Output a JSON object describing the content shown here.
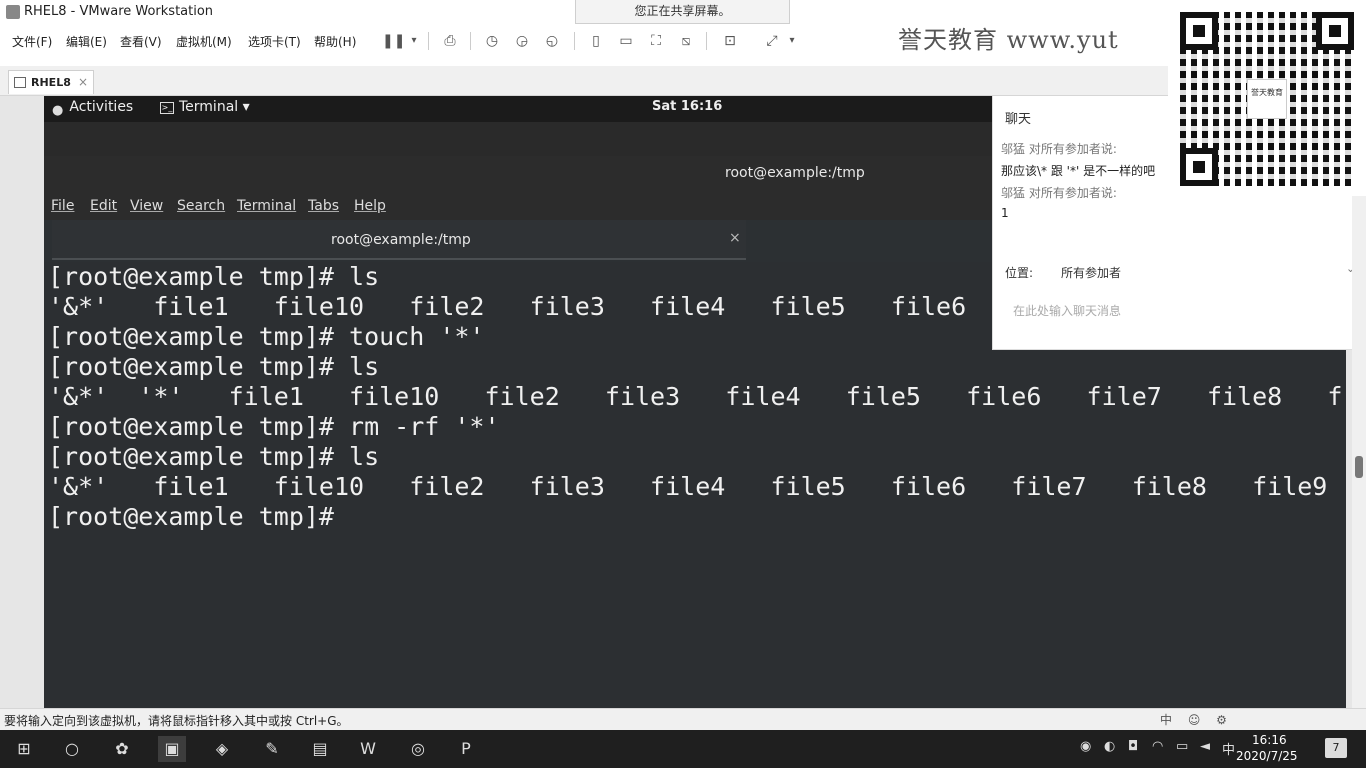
{
  "vmware": {
    "title": "RHEL8 - VMware Workstation",
    "share_banner": "您正在共享屏幕。",
    "menu": [
      "文件(F)",
      "编辑(E)",
      "查看(V)",
      "虚拟机(M)",
      "选项卡(T)",
      "帮助(H)"
    ],
    "brand": "誉天教育  www.yut",
    "tab_label": "RHEL8",
    "tab_close": "×",
    "status_text": "要将输入定向到该虚拟机，请将鼠标指针移入其中或按 Ctrl+G。",
    "status_ime": "中 ☺ ⚙"
  },
  "gnome": {
    "activities": "Activities",
    "terminal_menu": "Terminal ▾",
    "clock": "Sat 16:16"
  },
  "terminal": {
    "window_title": "root@example:/tmp",
    "menu": [
      "File",
      "Edit",
      "View",
      "Search",
      "Terminal",
      "Tabs",
      "Help"
    ],
    "tab_title": "root@example:/tmp",
    "tab_close": "×",
    "lines": [
      "[root@example tmp]# ls",
      "'&*'   file1   file10   file2   file3   file4   file5   file6",
      "[root@example tmp]# touch '*'",
      "[root@example tmp]# ls",
      "'&*'  '*'   file1   file10   file2   file3   file4   file5   file6   file7   file8   f",
      "[root@example tmp]# rm -rf '*'",
      "[root@example tmp]# ls",
      "'&*'   file1   file10   file2   file3   file4   file5   file6   file7   file8   file9",
      "[root@example tmp]#"
    ]
  },
  "chat": {
    "title": "聊天",
    "sender1": "邬猛 对所有参加者说:",
    "message1": "那应该\\* 跟 '*' 是不一样的吧",
    "sender2": "邬猛 对所有参加者说:",
    "message2": "1",
    "to_label": "位置:",
    "to_value": "所有参加者",
    "to_caret": "⌄",
    "input_placeholder": "在此处输入聊天消息"
  },
  "qr": {
    "logo_text": "誉天教育"
  },
  "taskbar": {
    "time": "16:16",
    "date": "2020/7/25",
    "ime": "中",
    "notifications": "7"
  }
}
